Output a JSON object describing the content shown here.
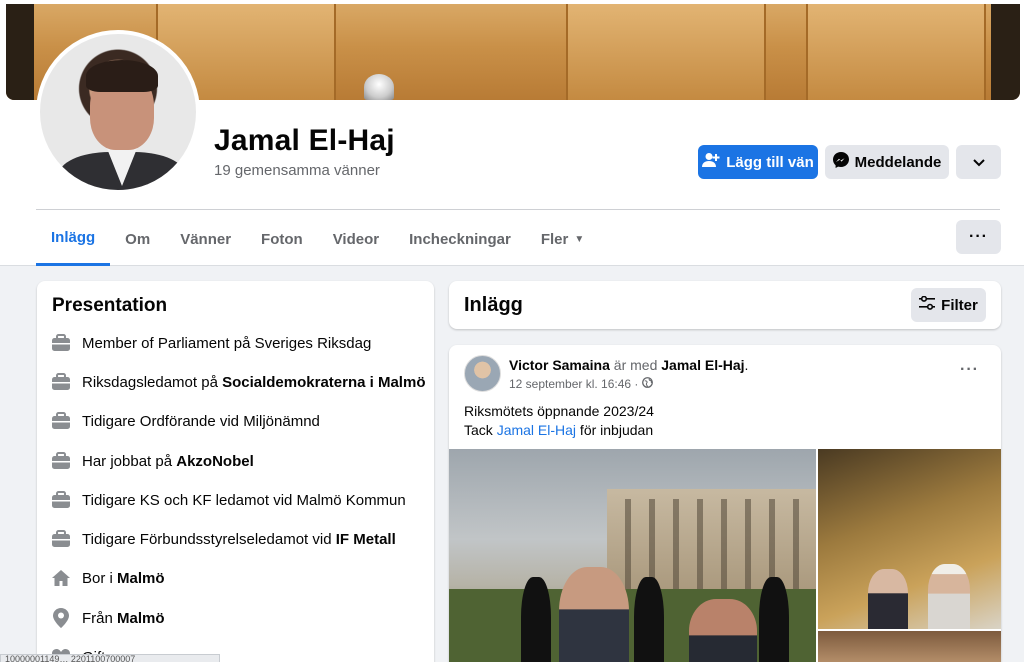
{
  "profile": {
    "name": "Jamal El-Haj",
    "mutual_friends": "19 gemensamma vänner"
  },
  "actions": {
    "add_friend": "Lägg till vän",
    "message": "Meddelande"
  },
  "tabs": [
    {
      "label": "Inlägg",
      "active": true
    },
    {
      "label": "Om"
    },
    {
      "label": "Vänner"
    },
    {
      "label": "Foton"
    },
    {
      "label": "Videor"
    },
    {
      "label": "Incheckningar"
    },
    {
      "label": "Fler"
    }
  ],
  "intro": {
    "title": "Presentation",
    "items": [
      {
        "icon": "briefcase-icon",
        "prefix": "Member of Parliament på Sveriges Riksdag",
        "bold": ""
      },
      {
        "icon": "briefcase-icon",
        "prefix": "Riksdagsledamot på ",
        "bold": "Socialdemokraterna i Malmö"
      },
      {
        "icon": "briefcase-icon",
        "prefix": "Tidigare Ordförande vid Miljönämnd",
        "bold": ""
      },
      {
        "icon": "briefcase-icon",
        "prefix": "Har jobbat på ",
        "bold": "AkzoNobel"
      },
      {
        "icon": "briefcase-icon",
        "prefix": "Tidigare KS och KF ledamot vid Malmö Kommun",
        "bold": ""
      },
      {
        "icon": "briefcase-icon",
        "prefix": "Tidigare Förbundsstyrelseledamot vid ",
        "bold": "IF Metall"
      },
      {
        "icon": "home-icon",
        "prefix": "Bor i ",
        "bold": "Malmö"
      },
      {
        "icon": "location-pin-icon",
        "prefix": "Från ",
        "bold": "Malmö"
      },
      {
        "icon": "heart-icon",
        "prefix": "Gift",
        "bold": ""
      }
    ]
  },
  "posts": {
    "title": "Inlägg",
    "filter_label": "Filter"
  },
  "post": {
    "author": "Victor Samaina",
    "with_text": " är med ",
    "tagged": "Jamal El-Haj",
    "period": ".",
    "timestamp": "12 september kl. 16:46 ·",
    "line1": "Riksmötets öppnande 2023/24",
    "line2_prefix": "Tack ",
    "line2_link": "Jamal El-Haj",
    "line2_suffix": " för inbjudan"
  },
  "statusbar": {
    "text": "10000001149… 2201100700007"
  },
  "colors": {
    "accent": "#1b74e4",
    "background": "#f0f2f5",
    "secondary_button": "#e4e6eb"
  }
}
